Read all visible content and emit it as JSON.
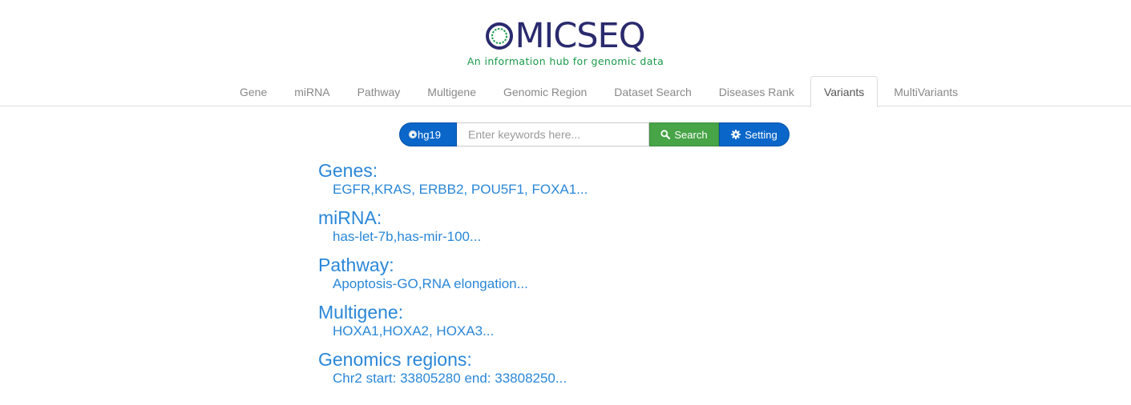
{
  "logo": {
    "text": "MICSEQ",
    "tagline": "An information hub for genomic data"
  },
  "nav": {
    "tabs": [
      {
        "label": "Gene",
        "active": false
      },
      {
        "label": "miRNA",
        "active": false
      },
      {
        "label": "Pathway",
        "active": false
      },
      {
        "label": "Multigene",
        "active": false
      },
      {
        "label": "Genomic Region",
        "active": false
      },
      {
        "label": "Dataset Search",
        "active": false
      },
      {
        "label": "Diseases Rank",
        "active": false
      },
      {
        "label": "Variants",
        "active": true
      },
      {
        "label": "MultiVariants",
        "active": false
      }
    ]
  },
  "search": {
    "genome": "hg19",
    "placeholder": "Enter keywords here...",
    "value": "",
    "search_label": "Search",
    "setting_label": "Setting"
  },
  "examples": [
    {
      "title": "Genes:",
      "value": "EGFR,KRAS, ERBB2, POU5F1, FOXA1..."
    },
    {
      "title": "miRNA:",
      "value": "has-let-7b,has-mir-100..."
    },
    {
      "title": "Pathway:",
      "value": "Apoptosis-GO,RNA elongation..."
    },
    {
      "title": "Multigene:",
      "value": "HOXA1,HOXA2, HOXA3..."
    },
    {
      "title": "Genomics regions:",
      "value": "Chr2 start: 33805280 end: 33808250..."
    }
  ],
  "colors": {
    "logo_navy": "#2a2a6e",
    "logo_green": "#1a9a4a",
    "primary_blue": "#0a67c9",
    "success_green": "#47a447",
    "link_blue": "#2a87d8"
  },
  "icons": {
    "logo": "omicseq-logo-circle-icon",
    "genome": "radio-icon",
    "search": "search-icon",
    "setting": "gear-icon"
  }
}
